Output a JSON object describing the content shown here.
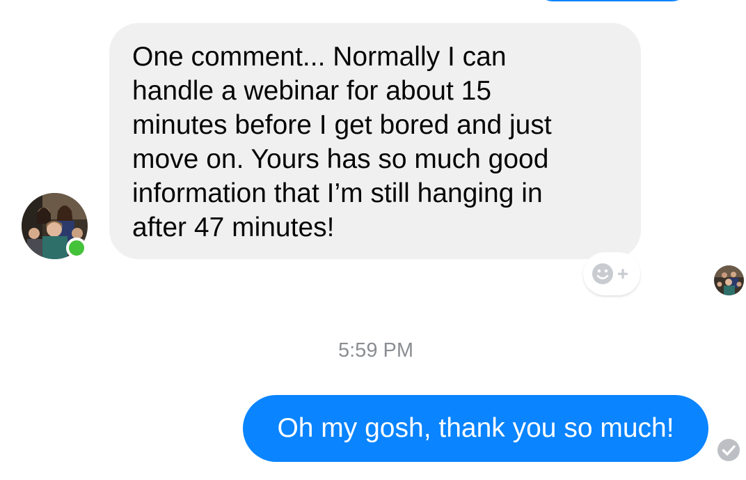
{
  "conversation": {
    "incoming_message": {
      "text": "One comment... Normally I can\nhandle a webinar for about 15\nminutes before I get bored and just\nmove on. Yours has so much good\ninformation that I’m still hanging in\nafter 47 minutes!",
      "sender_online": true,
      "react_icon": "smiley-plus-icon"
    },
    "timestamp": "5:59 PM",
    "outgoing_message": {
      "text": "Oh my gosh, thank you so much!",
      "status_icon": "delivered-check-icon"
    }
  },
  "colors": {
    "outgoing_bubble": "#0a84ff",
    "incoming_bubble": "#f0f0f0",
    "online_indicator": "#44c239",
    "timestamp_text": "#8a8d91"
  }
}
